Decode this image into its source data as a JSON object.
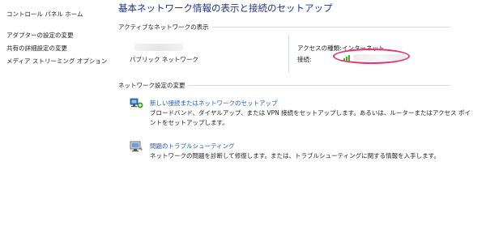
{
  "sidebar": {
    "home_link": "コントロール パネル ホーム",
    "items": [
      "アダプターの設定の変更",
      "共有の詳細設定の変更",
      "メディア ストリーミング オプション"
    ]
  },
  "page_title": "基本ネットワーク情報の表示と接続のセットアップ",
  "active_networks": {
    "heading": "アクティブなネットワークの表示",
    "network_name": "パブリック ネットワーク",
    "access_type_label": "アクセスの種類:",
    "access_type_value": "インターネット",
    "connection_label": "接続:"
  },
  "change_settings": {
    "heading": "ネットワーク設定の変更",
    "tasks": [
      {
        "icon": "network-setup-icon",
        "link": "新しい接続またはネットワークのセットアップ",
        "description": "ブロードバンド、ダイヤルアップ、または VPN 接続をセットアップします。あるいは、ルーターまたはアクセス ポイントをセットアップします。"
      },
      {
        "icon": "troubleshoot-icon",
        "link": "問題のトラブルシューティング",
        "description": "ネットワークの問題を診断して修復します。または、トラブルシューティングに関する情報を入手します。"
      }
    ]
  },
  "colors": {
    "title": "#1e3287",
    "link": "#1e5ab9",
    "highlight": "#e8336e",
    "signal": "#4caf2c"
  }
}
